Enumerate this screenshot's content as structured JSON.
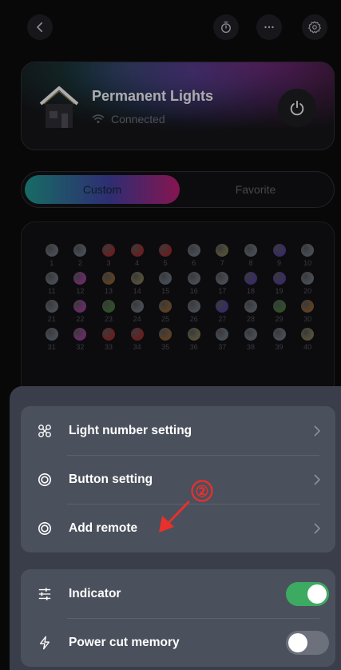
{
  "header": {
    "icons": [
      "back-icon",
      "timer-icon",
      "more-icon",
      "settings-icon"
    ]
  },
  "device": {
    "name": "Permanent Lights",
    "status": "Connected"
  },
  "tabs": [
    {
      "label": "Custom",
      "active": true
    },
    {
      "label": "Favorite",
      "active": false
    }
  ],
  "lights": [
    {
      "n": "1",
      "color": "#5f6670"
    },
    {
      "n": "2",
      "color": "#5f6670"
    },
    {
      "n": "3",
      "color": "#8a2a2a"
    },
    {
      "n": "4",
      "color": "#8a2a2a"
    },
    {
      "n": "5",
      "color": "#8a2a2a"
    },
    {
      "n": "6",
      "color": "#5f6670"
    },
    {
      "n": "7",
      "color": "#6d6a4a"
    },
    {
      "n": "8",
      "color": "#5f6670"
    },
    {
      "n": "9",
      "color": "#4b3b84"
    },
    {
      "n": "10",
      "color": "#5f6670"
    },
    {
      "n": "11",
      "color": "#5f6670"
    },
    {
      "n": "12",
      "color": "#8a3b86"
    },
    {
      "n": "13",
      "color": "#7a5530"
    },
    {
      "n": "14",
      "color": "#6d6a4a"
    },
    {
      "n": "15",
      "color": "#5f6670"
    },
    {
      "n": "16",
      "color": "#5f6670"
    },
    {
      "n": "17",
      "color": "#5f6670"
    },
    {
      "n": "18",
      "color": "#4b3b84"
    },
    {
      "n": "19",
      "color": "#4b3b84"
    },
    {
      "n": "20",
      "color": "#5f6670"
    },
    {
      "n": "21",
      "color": "#5f6670"
    },
    {
      "n": "22",
      "color": "#8a3b86"
    },
    {
      "n": "23",
      "color": "#3f6a36"
    },
    {
      "n": "24",
      "color": "#5f6670"
    },
    {
      "n": "25",
      "color": "#7a5530"
    },
    {
      "n": "26",
      "color": "#5f6670"
    },
    {
      "n": "27",
      "color": "#4b3b84"
    },
    {
      "n": "28",
      "color": "#5f6670"
    },
    {
      "n": "29",
      "color": "#3f6a36"
    },
    {
      "n": "30",
      "color": "#7a5530"
    },
    {
      "n": "31",
      "color": "#5f6670"
    },
    {
      "n": "32",
      "color": "#8a3b86"
    },
    {
      "n": "33",
      "color": "#8a2a2a"
    },
    {
      "n": "34",
      "color": "#8a2a2a"
    },
    {
      "n": "35",
      "color": "#7a5530"
    },
    {
      "n": "36",
      "color": "#6d6a4a"
    },
    {
      "n": "37",
      "color": "#5f6670"
    },
    {
      "n": "38",
      "color": "#5f6670"
    },
    {
      "n": "39",
      "color": "#5f6670"
    },
    {
      "n": "40",
      "color": "#6d6a4a"
    }
  ],
  "sheet": {
    "group1": [
      {
        "label": "Light number setting",
        "icon": "link-nodes-icon"
      },
      {
        "label": "Button setting",
        "icon": "radio-button-icon"
      },
      {
        "label": "Add remote",
        "icon": "radio-button-icon"
      }
    ],
    "group2": [
      {
        "label": "Indicator",
        "icon": "sliders-icon",
        "toggle": true
      },
      {
        "label": "Power cut memory",
        "icon": "lightning-icon",
        "toggle": false
      }
    ]
  },
  "annotation": {
    "marker": "②",
    "color": "#e8302c"
  },
  "colors": {
    "accent_green": "#3daa62",
    "sheet_bg": "#3a3e4a"
  }
}
